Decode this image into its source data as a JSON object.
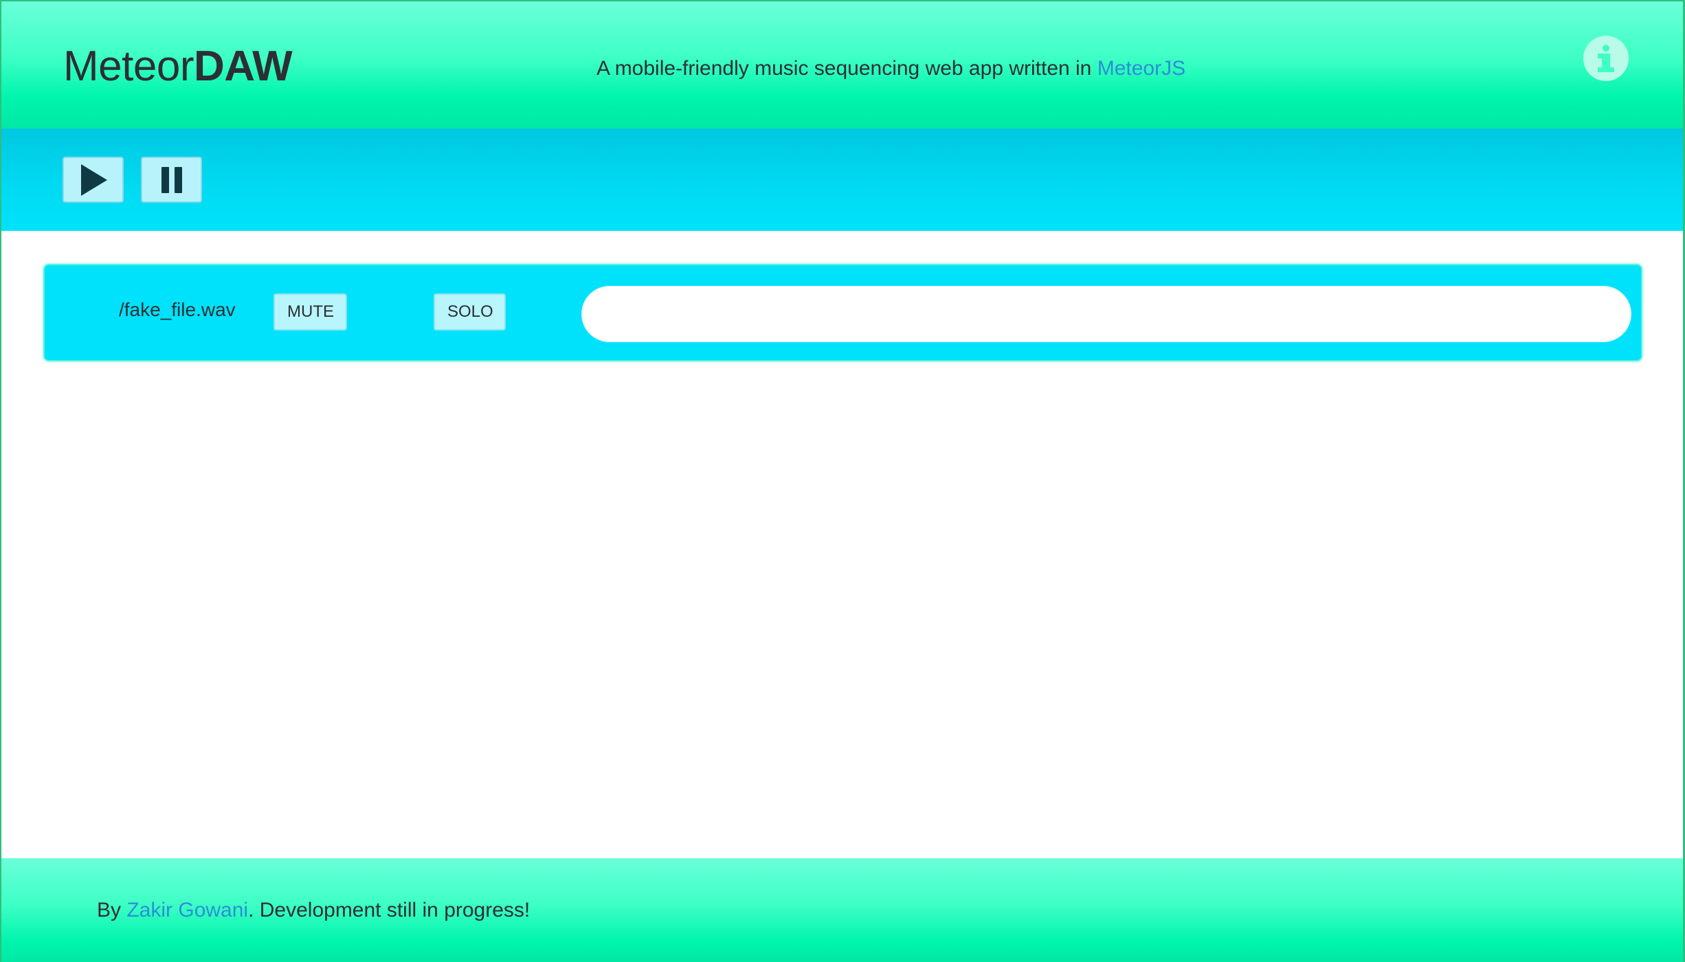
{
  "header": {
    "brand_light": "Meteor",
    "brand_bold": "DAW",
    "tagline_prefix": "A mobile-friendly music sequencing web app written in ",
    "tagline_link": "MeteorJS",
    "info_icon": "info-icon"
  },
  "transport": {
    "play_icon": "play-icon",
    "pause_icon": "pause-icon"
  },
  "tracks": [
    {
      "name": "/fake_file.wav",
      "mute_label": "MUTE",
      "solo_label": "SOLO"
    }
  ],
  "footer": {
    "prefix": "By ",
    "author_link": "Zakir Gowani",
    "suffix": ". Development still in progress!"
  },
  "colors": {
    "header_green": "#00f5ad",
    "transport_cyan": "#00e3fb",
    "link_blue": "#2b8fd6",
    "button_bg": "#b8f3fc"
  }
}
